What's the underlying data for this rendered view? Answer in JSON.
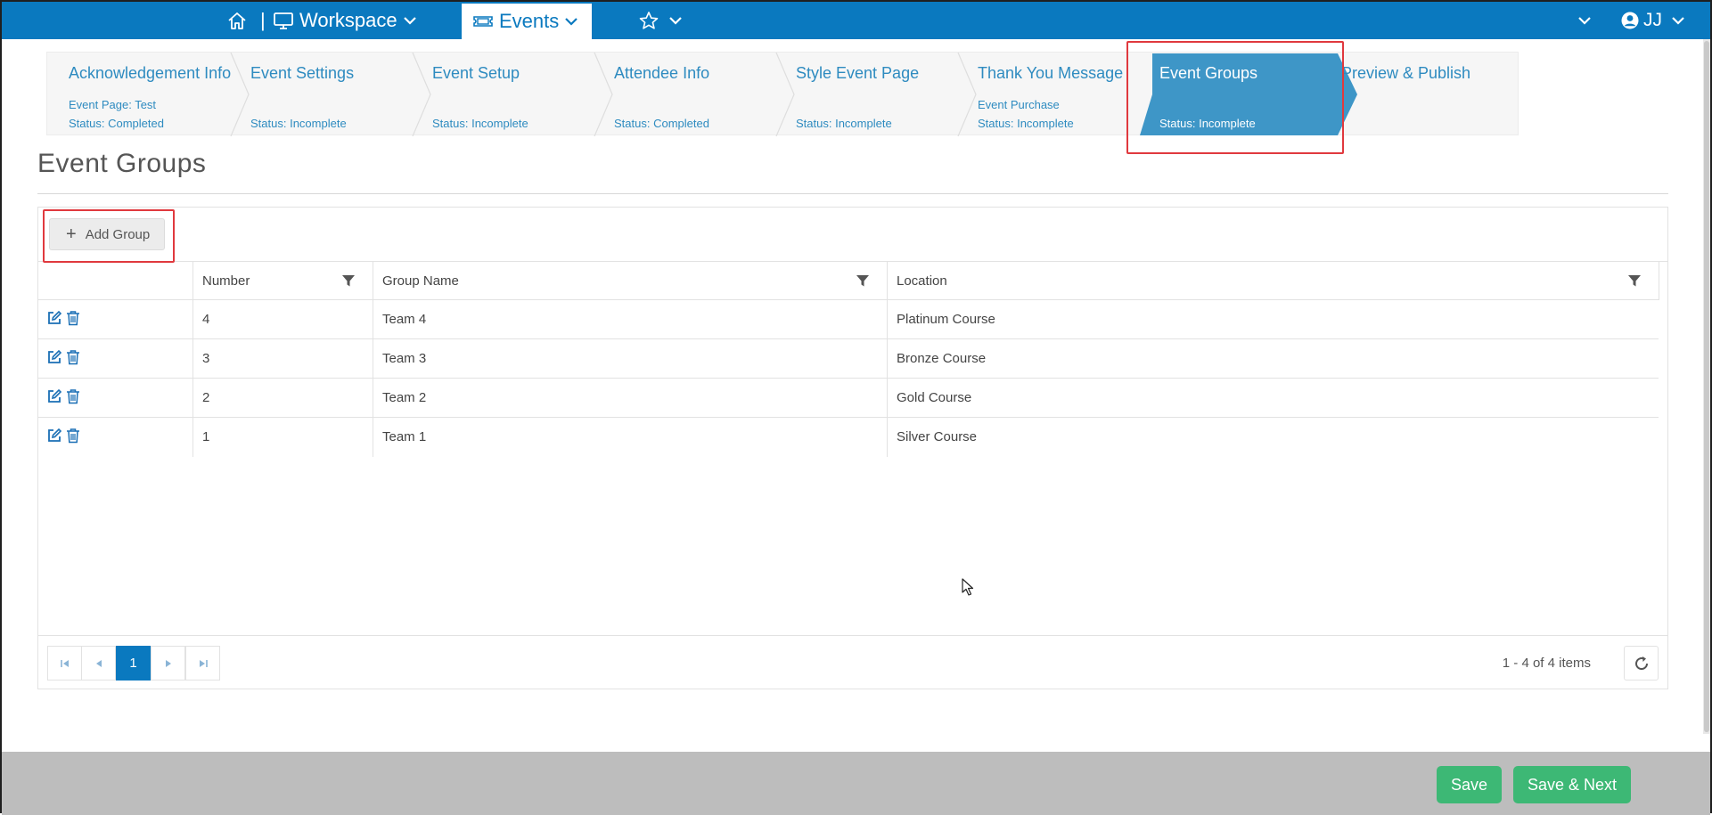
{
  "topnav": {
    "home_icon": "home-icon",
    "separator": "|",
    "workspace_label": "Workspace",
    "events_label": "Events",
    "star_icon": "star-icon",
    "user_initials": "JJ"
  },
  "wizard": {
    "steps": [
      {
        "title": "Acknowledgement Info",
        "line1": "Event Page: Test",
        "line2": "Status: Completed"
      },
      {
        "title": "Event Settings",
        "line1": "",
        "line2": "Status: Incomplete"
      },
      {
        "title": "Event Setup",
        "line1": "",
        "line2": "Status: Incomplete"
      },
      {
        "title": "Attendee Info",
        "line1": "",
        "line2": "Status: Completed"
      },
      {
        "title": "Style Event Page",
        "line1": "",
        "line2": "Status: Incomplete"
      },
      {
        "title": "Thank You Message",
        "line1": "Event Purchase",
        "line2": "Status: Incomplete"
      },
      {
        "title": "Event Groups",
        "line1": "",
        "line2": "Status: Incomplete"
      },
      {
        "title": "Preview & Publish",
        "line1": "",
        "line2": ""
      }
    ],
    "active_index": 6,
    "active_color": "#3e96c7"
  },
  "page": {
    "title": "Event Groups"
  },
  "toolbar": {
    "add_group_label": "Add Group"
  },
  "grid": {
    "columns": [
      "Number",
      "Group Name",
      "Location"
    ],
    "rows": [
      {
        "number": "4",
        "group_name": "Team 4",
        "location": "Platinum Course"
      },
      {
        "number": "3",
        "group_name": "Team 3",
        "location": "Bronze Course"
      },
      {
        "number": "2",
        "group_name": "Team 2",
        "location": "Gold Course"
      },
      {
        "number": "1",
        "group_name": "Team 1",
        "location": "Silver Course"
      }
    ]
  },
  "pager": {
    "current_page": "1",
    "info": "1 - 4 of 4 items"
  },
  "footer": {
    "save_label": "Save",
    "save_next_label": "Save & Next"
  },
  "colors": {
    "nav": "#0a79bf",
    "save": "#3db875",
    "highlight": "#e0393e"
  }
}
